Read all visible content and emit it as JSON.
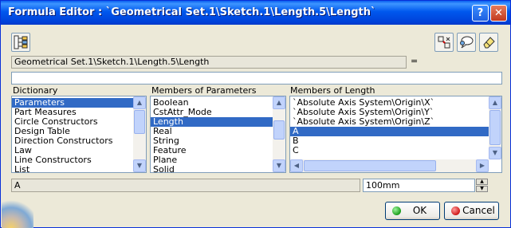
{
  "window": {
    "title": "Formula Editor : `Geometrical Set.1\\Sketch.1\\Length.5\\Length`",
    "help_glyph": "?",
    "close_glyph": "✕"
  },
  "toolbar": {
    "left_icon": "formula-tree-icon",
    "right_icons": [
      "measure-icon",
      "comment-icon",
      "eraser-icon"
    ]
  },
  "parameter_path": "Geometrical Set.1\\Sketch.1\\Length.5\\Length",
  "equals_label": "=",
  "formula": {
    "value": "",
    "placeholder": ""
  },
  "dictionary": {
    "label": "Dictionary",
    "items": [
      "Parameters",
      "Part Measures",
      "Circle Constructors",
      "Design Table",
      "Direction Constructors",
      "Law",
      "Line Constructors",
      "List"
    ],
    "selected_index": 0
  },
  "members_of_parameters": {
    "label": "Members of Parameters",
    "items": [
      "Boolean",
      "CstAttr_Mode",
      "Length",
      "Real",
      "String",
      "Feature",
      "Plane",
      "Solid"
    ],
    "selected_index": 2
  },
  "members_of_length": {
    "label": "Members of Length",
    "items": [
      "`Absolute Axis System\\Origin\\X`",
      "`Absolute Axis System\\Origin\\Y`",
      "`Absolute Axis System\\Origin\\Z`",
      "A",
      "B",
      "C"
    ],
    "selected_index": 3
  },
  "selected_member_name": "A",
  "selected_member_value": "100mm",
  "buttons": {
    "ok": "OK",
    "cancel": "Cancel"
  }
}
